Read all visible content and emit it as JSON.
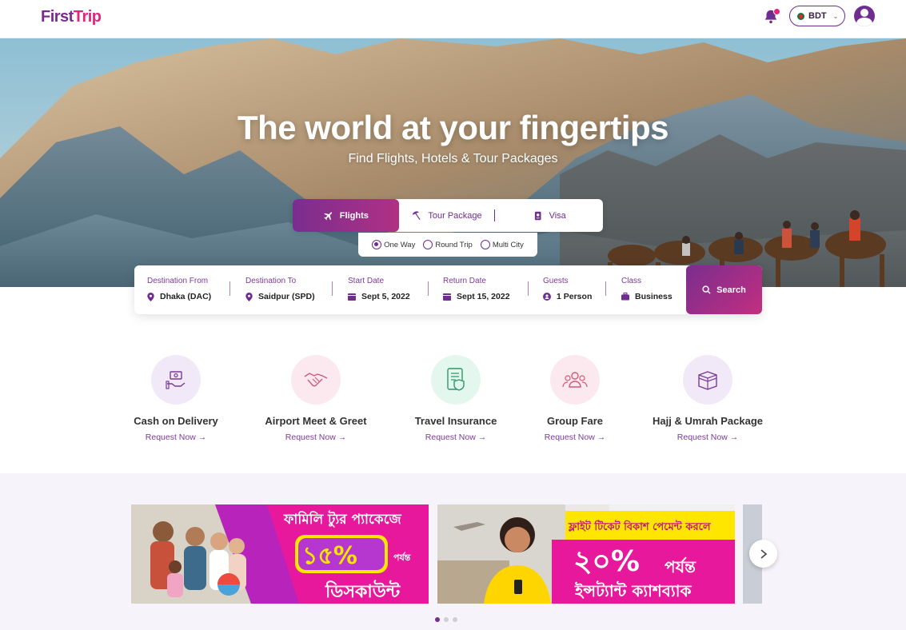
{
  "brand": {
    "logo_first": "First",
    "logo_trip": "Trip"
  },
  "header": {
    "currency": "BDT"
  },
  "hero": {
    "title": "The world at your fingertips",
    "subtitle": "Find Flights, Hotels & Tour Packages"
  },
  "tabs": [
    {
      "label": "Flights",
      "icon": "plane-icon",
      "active": true
    },
    {
      "label": "Tour Package",
      "icon": "beach-umbrella-icon",
      "active": false
    },
    {
      "label": "Visa",
      "icon": "passport-icon",
      "active": false
    }
  ],
  "trip_types": [
    {
      "label": "One Way",
      "selected": true
    },
    {
      "label": "Round Trip",
      "selected": false
    },
    {
      "label": "Multi City",
      "selected": false
    }
  ],
  "search": {
    "from_label": "Destination From",
    "from_value": "Dhaka (DAC)",
    "to_label": "Destination To",
    "to_value": "Saidpur (SPD)",
    "start_label": "Start Date",
    "start_value": "Sept 5, 2022",
    "return_label": "Return Date",
    "return_value": "Sept 15, 2022",
    "guests_label": "Guests",
    "guests_value": "1 Person",
    "class_label": "Class",
    "class_value": "Business",
    "button": "Search"
  },
  "services": [
    {
      "title": "Cash on Delivery",
      "link": "Request Now →",
      "icon": "cash-delivery-icon"
    },
    {
      "title": "Airport Meet & Greet",
      "link": "Request Now →",
      "icon": "handshake-icon"
    },
    {
      "title": "Travel Insurance",
      "link": "Request Now →",
      "icon": "insurance-document-icon"
    },
    {
      "title": "Group Fare",
      "link": "Request Now →",
      "icon": "group-icon"
    },
    {
      "title": "Hajj & Umrah Package",
      "link": "Request Now →",
      "icon": "kaaba-icon"
    }
  ],
  "banners": [
    {
      "line1": "ফামিলি ট্যুর প্যাকেজে",
      "big": "১৫%",
      "small": "পর্যন্ত",
      "line3": "ডিসকাউন্ট"
    },
    {
      "line1": "ফ্লাইট টিকেট বিকাশ পেমেন্ট করলে",
      "big": "২০%",
      "small": "পর্যন্ত",
      "line3": "ইন্সট্যান্ট ক্যাশব্যাক"
    }
  ],
  "colors": {
    "primary": "#6f2c91",
    "accent": "#e0257d",
    "promo_pink": "#e8189c",
    "promo_yellow": "#ffe600"
  }
}
